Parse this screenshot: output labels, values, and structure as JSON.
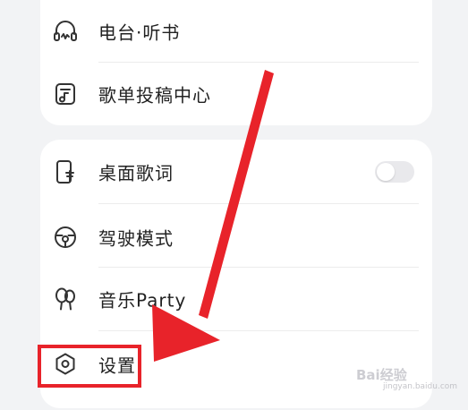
{
  "menu_top": {
    "items": [
      {
        "label": "电台·听书",
        "icon": "radio-headphones-icon"
      },
      {
        "label": "歌单投稿中心",
        "icon": "playlist-submit-icon"
      }
    ]
  },
  "menu_bottom": {
    "items": [
      {
        "label": "桌面歌词",
        "icon": "desktop-lyrics-icon",
        "toggle": "off"
      },
      {
        "label": "驾驶模式",
        "icon": "steering-wheel-icon"
      },
      {
        "label": "音乐Party",
        "icon": "balloon-icon"
      },
      {
        "label": "设置",
        "icon": "gear-icon"
      }
    ]
  },
  "annotations": {
    "arrow_color": "#e8232a",
    "highlight_color": "#e8232a"
  },
  "watermark": {
    "brand": "Bai经验",
    "sub": "jingyan.baidu.com"
  }
}
